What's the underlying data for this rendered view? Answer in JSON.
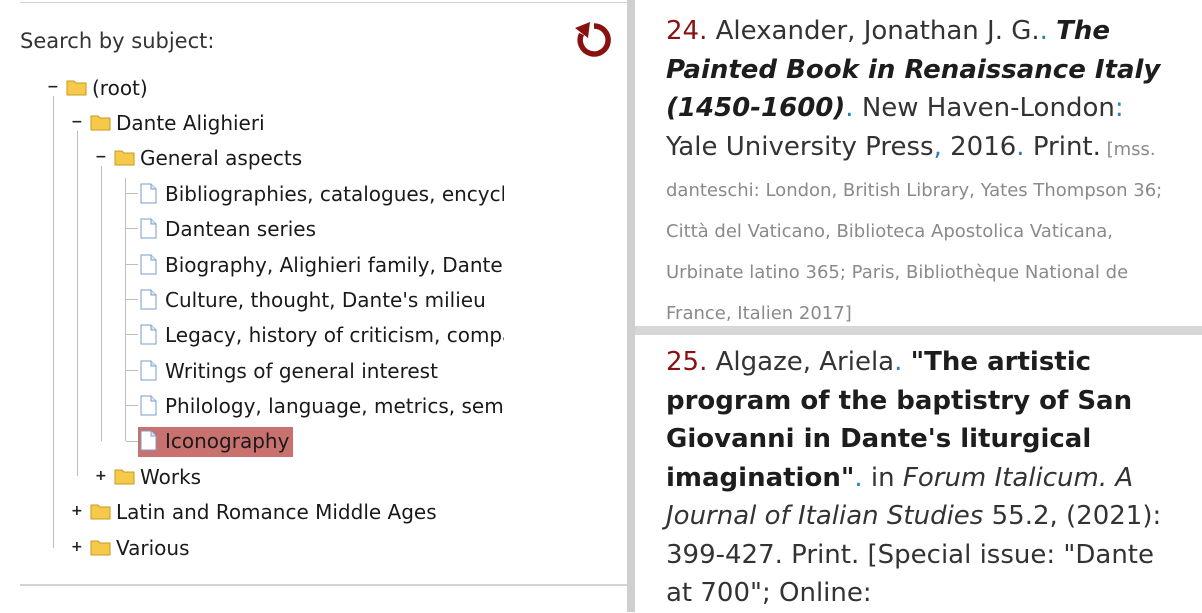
{
  "search": {
    "label": "Search by subject:"
  },
  "tree": {
    "root": "(root)",
    "dante": "Dante Alighieri",
    "general": "General aspects",
    "leaves": [
      "Bibliographies, catalogues, encyclo",
      "Dantean series",
      "Biography, Alighieri family, Dante's",
      "Culture, thought, Dante's milieu",
      "Legacy, history of criticism, compar",
      "Writings of general interest",
      "Philology, language, metrics, semic",
      "Iconography"
    ],
    "works": "Works",
    "latin": "Latin and Romance Middle Ages",
    "various": "Various",
    "selected_index": 7
  },
  "entries": {
    "e24": {
      "num": "24.",
      "author": " Alexander, Jonathan J. G.",
      "sep1": ". ",
      "title": "The Painted Book in Renaissance Italy (1450-1600)",
      "sep2": ". ",
      "place": "New Haven-London",
      "colon": ": ",
      "publisher": "Yale University Press",
      "comma": ", ",
      "year": "2016",
      "sep3": ". ",
      "medium": "Print.",
      "note": " [mss. danteschi: London, British Library, Yates Thompson 36; Città del Vaticano, Biblioteca Apostolica Vaticana, Urbinate latino 365; Paris, Bibliothèque National de France, Italien 2017]"
    },
    "e25": {
      "num": "25.",
      "author": " Algaze, Ariela",
      "sep1": ". ",
      "title": "\"The artistic program of the baptistry of San Giovanni in Dante's liturgical imagination\"",
      "sep2": ". ",
      "in": "in ",
      "journal": "Forum Italicum. A Journal of Italian Studies",
      "rest": " 55.2, (2021): 399-427. Print. [Special issue: \"Dante at 700\"; Online:"
    }
  },
  "colors": {
    "accent": "#8a1111",
    "selected": "#c9716f",
    "punct": "#2d7fb8"
  }
}
